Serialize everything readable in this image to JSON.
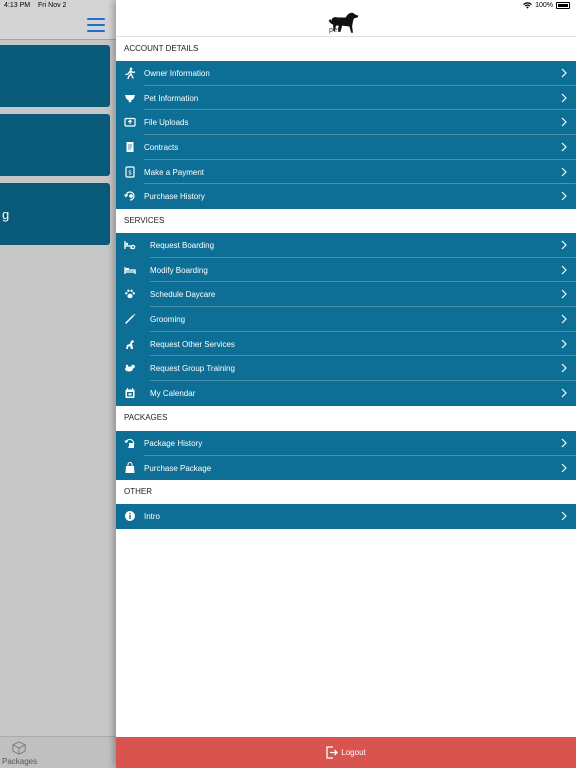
{
  "status_bar": {
    "time": "4:13 PM",
    "date": "Fri Nov 2",
    "battery": "100%"
  },
  "left_panel": {
    "card_partial_text": "g",
    "tab_label": "Packages"
  },
  "logo_text": "pet",
  "sections": [
    {
      "title": "ACCOUNT DETAILS",
      "items": [
        {
          "label": "Owner Information",
          "icon": "person-walking-icon"
        },
        {
          "label": "Pet Information",
          "icon": "pet-collar-icon"
        },
        {
          "label": "File Uploads",
          "icon": "file-upload-icon"
        },
        {
          "label": "Contracts",
          "icon": "contract-icon"
        },
        {
          "label": "Make a Payment",
          "icon": "payment-icon"
        },
        {
          "label": "Purchase History",
          "icon": "purchase-history-icon"
        }
      ]
    },
    {
      "title": "SERVICES",
      "items": [
        {
          "label": "Request Boarding",
          "icon": "request-boarding-icon"
        },
        {
          "label": "Modify Boarding",
          "icon": "bed-icon"
        },
        {
          "label": "Schedule Daycare",
          "icon": "paw-icon"
        },
        {
          "label": "Grooming",
          "icon": "grooming-icon"
        },
        {
          "label": "Request Other Services",
          "icon": "dog-service-icon"
        },
        {
          "label": "Request Group Training",
          "icon": "group-training-icon"
        },
        {
          "label": "My Calendar",
          "icon": "calendar-icon"
        }
      ]
    },
    {
      "title": "PACKAGES",
      "items": [
        {
          "label": "Package History",
          "icon": "package-history-icon"
        },
        {
          "label": "Purchase Package",
          "icon": "shopping-bag-icon"
        }
      ]
    },
    {
      "title": "OTHER",
      "items": [
        {
          "label": "Intro",
          "icon": "info-icon"
        }
      ]
    }
  ],
  "logout_label": "Logout",
  "colors": {
    "menu_bg": "#0e6f96",
    "logout_bg": "#d9534f",
    "accent": "#1f6fd1"
  }
}
